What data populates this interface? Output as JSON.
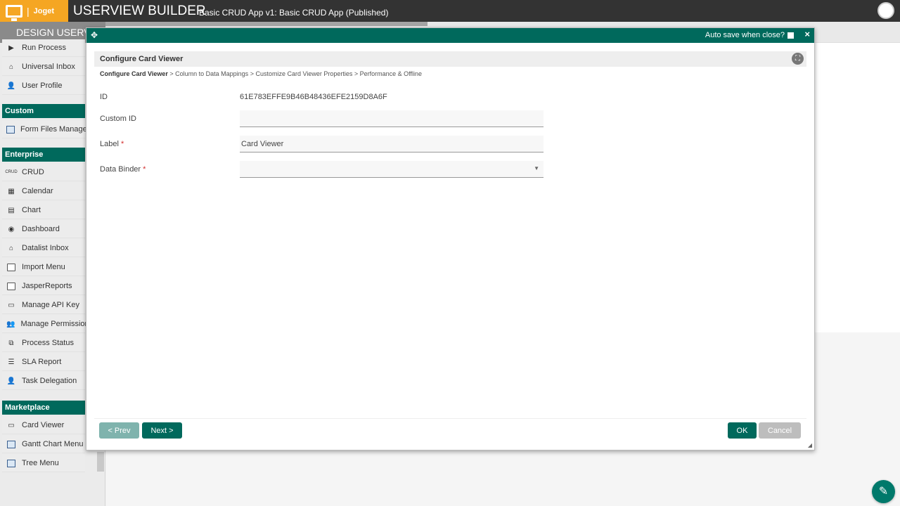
{
  "topbar": {
    "brand": "Joget",
    "title": "USERVIEW BUILDER",
    "subtitle": "Basic CRUD App v1: Basic CRUD App (Published)"
  },
  "subbar": {
    "design_tab": "DESIGN USERV"
  },
  "sidebar": {
    "items_top": [
      {
        "label": "Run Process",
        "icon": "play-icon"
      },
      {
        "label": "Universal Inbox",
        "icon": "inbox-icon"
      },
      {
        "label": "User Profile",
        "icon": "user-edit-icon"
      }
    ],
    "custom_header": "Custom",
    "custom_items": [
      {
        "label": "Form Files Manager",
        "icon": "plugin-icon"
      }
    ],
    "enterprise_header": "Enterprise",
    "enterprise_items": [
      {
        "label": "CRUD",
        "icon": "crud-icon",
        "icon_text": "CRUD"
      },
      {
        "label": "Calendar",
        "icon": "calendar-icon"
      },
      {
        "label": "Chart",
        "icon": "chart-icon"
      },
      {
        "label": "Dashboard",
        "icon": "dashboard-icon"
      },
      {
        "label": "Datalist Inbox",
        "icon": "inbox-icon"
      },
      {
        "label": "Import Menu",
        "icon": "import-icon"
      },
      {
        "label": "JasperReports",
        "icon": "report-icon"
      },
      {
        "label": "Manage API Key",
        "icon": "monitor-icon"
      },
      {
        "label": "Manage Permission",
        "icon": "users-icon"
      },
      {
        "label": "Process Status",
        "icon": "process-icon"
      },
      {
        "label": "SLA Report",
        "icon": "list-icon"
      },
      {
        "label": "Task Delegation",
        "icon": "delegate-icon"
      }
    ],
    "marketplace_header": "Marketplace",
    "marketplace_items": [
      {
        "label": "Card Viewer",
        "icon": "monitor-icon"
      },
      {
        "label": "Gantt Chart Menu",
        "icon": "plugin-icon"
      },
      {
        "label": "Tree Menu",
        "icon": "plugin-icon"
      }
    ]
  },
  "dialog": {
    "autosave_label": "Auto save when close?",
    "close": "×",
    "title": "Configure Card Viewer",
    "breadcrumb": {
      "active": "Configure Card Viewer",
      "sep": " > ",
      "steps": [
        "Column to Data Mappings",
        "Customize Card Viewer Properties",
        "Performance & Offline"
      ]
    },
    "fields": {
      "id_label": "ID",
      "id_value": "61E783EFFE9B46B48436EFE2159D8A6F",
      "custom_id_label": "Custom ID",
      "custom_id_value": "",
      "label_label": "Label",
      "label_value": "Card Viewer",
      "data_binder_label": "Data Binder",
      "data_binder_value": "",
      "required_mark": "*"
    },
    "buttons": {
      "prev": "< Prev",
      "next": "Next >",
      "ok": "OK",
      "cancel": "Cancel"
    }
  },
  "colors": {
    "accent": "#00695c",
    "brand": "#f5a623",
    "topbar": "#333333"
  }
}
